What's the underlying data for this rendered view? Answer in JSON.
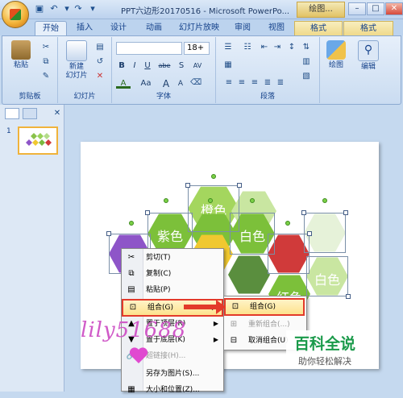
{
  "window": {
    "title": "PPT六边形20170516 - Microsoft PowerPo...",
    "contextual_tool": "绘图...",
    "controls": [
      "–",
      "□",
      "✕"
    ]
  },
  "tabs": [
    "开始",
    "插入",
    "设计",
    "动画",
    "幻灯片放映",
    "审阅",
    "视图",
    "格式",
    "格式"
  ],
  "ribbon": {
    "clipboard": {
      "paste": "粘贴",
      "group": "剪贴板"
    },
    "slides": {
      "new_slide_line1": "新建",
      "new_slide_line2": "幻灯片",
      "group": "幻灯片"
    },
    "font": {
      "size": "18+",
      "group": "字体",
      "buttons": [
        "B",
        "I",
        "U",
        "abe",
        "S",
        "AV",
        "A",
        "Aa",
        "A",
        "A"
      ]
    },
    "paragraph": {
      "group": "段落"
    },
    "drawing": {
      "label": "绘图"
    },
    "editing": {
      "label": "编辑"
    }
  },
  "slide_pane": {
    "slide_number": "1"
  },
  "slide": {
    "hex_labels": [
      "橙色",
      "紫色",
      "白色",
      "白色",
      "红色"
    ]
  },
  "context_menu": {
    "items": [
      {
        "icon": "✂",
        "label": "剪切(T)"
      },
      {
        "icon": "⧉",
        "label": "复制(C)"
      },
      {
        "icon": "▤",
        "label": "粘贴(P)"
      },
      {
        "icon": "⊡",
        "label": "组合(G)"
      },
      {
        "icon": "▲",
        "label": "置于顶层(R)"
      },
      {
        "icon": "▼",
        "label": "置于底层(K)"
      },
      {
        "icon": "🔗",
        "label": "超链接(H)..."
      },
      {
        "icon": "",
        "label": "另存为图片(S)..."
      },
      {
        "icon": "▦",
        "label": "大小和位置(Z)..."
      }
    ]
  },
  "submenu": {
    "items": [
      {
        "label": "组合(G)"
      },
      {
        "label": "重新组合(...)"
      },
      {
        "label": "取消组合(U)"
      }
    ]
  },
  "watermark": {
    "main": "百科全说",
    "sub": "助你轻松解决"
  },
  "signature": "lily51688",
  "colors": {
    "highlight": "#e33a2a",
    "hex_green": "#7cc03a",
    "hex_purple": "#8e55c8"
  }
}
